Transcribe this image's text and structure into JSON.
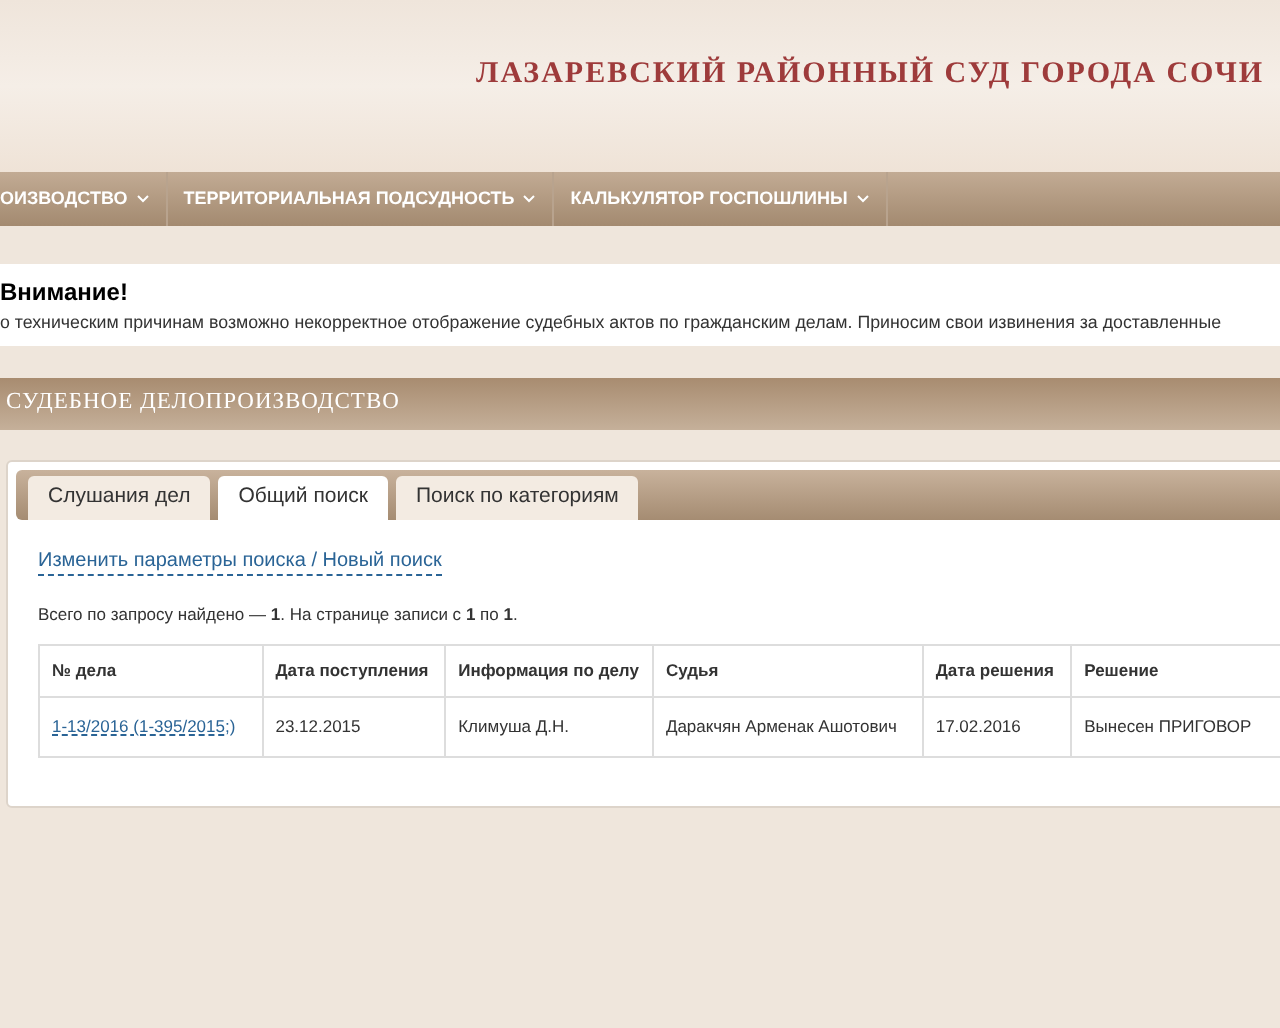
{
  "header": {
    "title": "ЛАЗАРЕВСКИЙ РАЙОННЫЙ СУД ГОРОДА СОЧИ"
  },
  "nav": [
    {
      "label": "ОИЗВОДСТВО"
    },
    {
      "label": "ТЕРРИТОРИАЛЬНАЯ ПОДСУДНОСТЬ"
    },
    {
      "label": "КАЛЬКУЛЯТОР ГОСПОШЛИНЫ"
    }
  ],
  "notice": {
    "title": "Внимание!",
    "text": "о техническим причинам возможно некорректное отображение судебных актов по гражданским делам. Приносим свои извинения за доставленные"
  },
  "section": {
    "title": "СУДЕБНОЕ ДЕЛОПРОИЗВОДСТВО"
  },
  "tabs": [
    {
      "label": "Слушания дел",
      "selected": false
    },
    {
      "label": "Общий поиск",
      "selected": true
    },
    {
      "label": "Поиск по категориям",
      "selected": false
    }
  ],
  "search_link": "Изменить параметры поиска / Новый поиск",
  "summary": "Всего по запросу найдено — **1**. На странице записи с **1** по **1**.",
  "table": {
    "columns": [
      "№ дела",
      "Дата поступления",
      "Информация по делу",
      "Судья",
      "Дата решения",
      "Решение"
    ],
    "rows": [
      {
        "cells": [
          "1-13/2016 (1-395/2015;)",
          "23.12.2015",
          "Климуша Д.Н.",
          "Даракчян Арменак Ашотович",
          "17.02.2016",
          "Вынесен ПРИГОВОР"
        ]
      }
    ]
  }
}
